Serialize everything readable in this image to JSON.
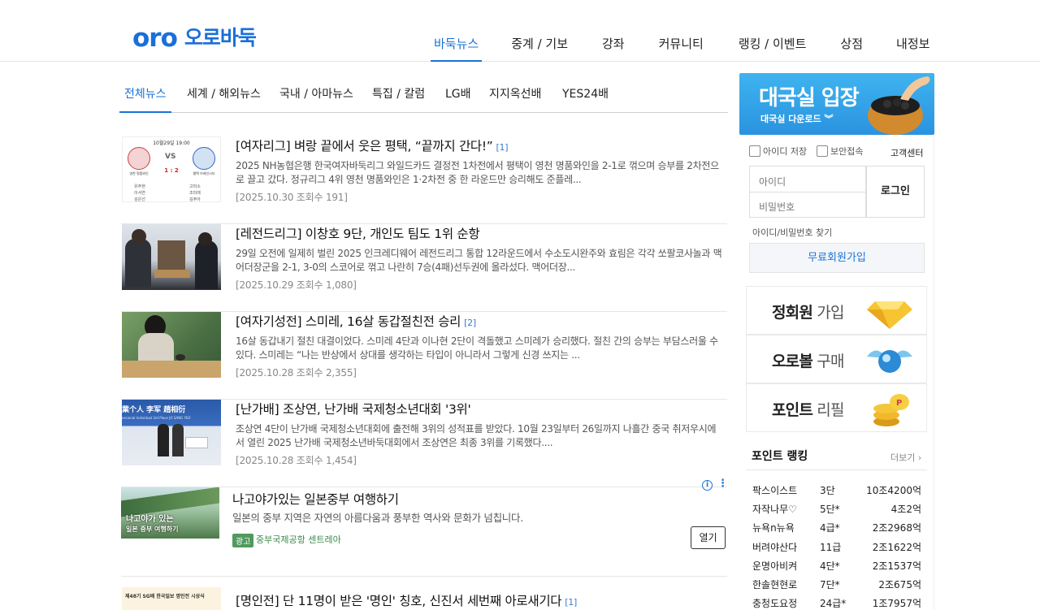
{
  "logo": {
    "mark": "oro",
    "text": "오로바둑"
  },
  "gnb": [
    {
      "label": "바둑뉴스",
      "active": true
    },
    {
      "label": "중계 / 기보"
    },
    {
      "label": "강좌"
    },
    {
      "label": "커뮤니티"
    },
    {
      "label": "랭킹 / 이벤트"
    },
    {
      "label": "상점"
    },
    {
      "label": "내정보"
    }
  ],
  "subtabs": [
    {
      "label": "전체뉴스",
      "active": true
    },
    {
      "label": "세계 / 해외뉴스"
    },
    {
      "label": "국내 / 아마뉴스"
    },
    {
      "label": "특집 / 칼럼"
    },
    {
      "label": "LG배"
    },
    {
      "label": "지지옥선배"
    },
    {
      "label": "YES24배"
    }
  ],
  "news": [
    {
      "title": "[여자리그] 벼랑 끝에서 웃은 평택, “끝까지 간다!”",
      "count": "[1]",
      "summary": "2025 NH농협은행 한국여자바둑리그 와일드카드 결정전 1차전에서 평택이 영천 명품와인을 2-1로 꺾으며 승부를 2차전으로 끌고 갔다. 정규리그 4위 영천 명품와인은 1·2차전 중 한 라운드만 승리해도 준플레...",
      "meta": "[2025.10.30  조회수 191]",
      "thumb": {
        "date": "10월29일 19:00",
        "vs": "VS",
        "score": "1 : 2",
        "team1": "영천 명품와인",
        "team2": "평택 브레인시티",
        "players": [
          "유주현",
          "고미소",
          "이서연",
          "조미래",
          "김은선",
          "김주아"
        ]
      }
    },
    {
      "title": "[레전드리그] 이창호 9단, 개인도 팀도 1위 순항",
      "count": "",
      "summary": "29일 오전에 일제히 벌린 2025 인크레디웨어 레전드리그 통합 12라운드에서 수소도시완주와 효림은 각각 쏘팔코사놀과 맥어더장군을 2-1, 3-0의 스코어로 꺾고 나란히 7승(4패)선두권에 올라섰다. 맥어더장...",
      "meta": "[2025.10.29  조회수 1,080]"
    },
    {
      "title": "[여자기성전] 스미레, 16살 동갑절친전 승리",
      "count": "[2]",
      "summary": "16살 동갑내기 절친 대결이었다. 스미레 4단과 이나현 2단이 격돌했고 스미레가 승리했다. 절친 간의 승부는 부담스러울 수 있다. 스미레는 “나는 반상에서 상대를 생각하는 타입이 아니라서 그렇게 신경 쓰지는 ...",
      "meta": "[2025.10.28  조회수 2,355]"
    },
    {
      "title": "[난가배] 조상연, 난가배 국제청소년대회 '3위'",
      "count": "",
      "summary": "조상연 4단이 난가배 국제청소년대회에 출전해 3위의 성적표를 받았다. 10월 23일부터 26일까지 나흘간 중국 취저우시에서 열린 2025 난가배 국제청소년바둑대회에서 조상연은 최종 3위를 기록했다....",
      "meta": "[2025.10.28  조회수 1,454]",
      "thumb": {
        "line1": "業个人 李军  趙相衍",
        "line2": "essional Individual 3rd Place   JO SANG YEO"
      }
    },
    {
      "title": "[명인전] 단 11명이 받은 '명인' 칭호, 신진서 세번째 아로새기다",
      "count": "[1]",
      "thumb": {
        "line1": "제48기 SG배 한국일보 명인전 시상식"
      }
    }
  ],
  "ad": {
    "title": "나고야가있는 일본중부 여행하기",
    "desc": "일본의 중부 지역은 자연의 아름다움과 풍부한 역사와 문화가 넘칩니다.",
    "badge": "광고",
    "source": "중부국제공항 센트레아",
    "button": "열기",
    "img_text1": "나고야가 있는",
    "img_text2": "일본 중부 여행하기"
  },
  "enter": {
    "title": "대국실 입장",
    "sub": "대국실 다운로드 ︾"
  },
  "login": {
    "save_id": "아이디 저장",
    "secure": "보안접속",
    "cs": "고객센터",
    "id_placeholder": "아이디",
    "pw_placeholder": "비밀번호",
    "login_button": "로그인",
    "find": "아이디/비밀번호 찾기",
    "join": "무료회원가입"
  },
  "promos": [
    {
      "bold": "정회원",
      "rest": " 가입",
      "icon": "diamond-icon"
    },
    {
      "bold": "오로볼",
      "rest": " 구매",
      "icon": "orb-icon"
    },
    {
      "bold": "포인트",
      "rest": " 리필",
      "icon": "coins-icon"
    }
  ],
  "ranking": {
    "title": "포인트 랭킹",
    "more": "더보기 ›",
    "rows": [
      {
        "name": "팍스이스트",
        "grade": "3단",
        "points": "10조4200억"
      },
      {
        "name": "자작나무♡",
        "grade": "5단*",
        "points": "4조2억"
      },
      {
        "name": "뉴욕n뉴욕",
        "grade": "4급*",
        "points": "2조2968억"
      },
      {
        "name": "버려야산다",
        "grade": "11급",
        "points": "2조1622억"
      },
      {
        "name": "운명아비켜",
        "grade": "4단*",
        "points": "2조1537억"
      },
      {
        "name": "한솔현현로",
        "grade": "7단*",
        "points": "2조675억"
      },
      {
        "name": "충청도요정",
        "grade": "24급*",
        "points": "1조7957억"
      }
    ]
  },
  "colors": {
    "brand": "#1a6fd8",
    "accent": "#1a73d6"
  }
}
